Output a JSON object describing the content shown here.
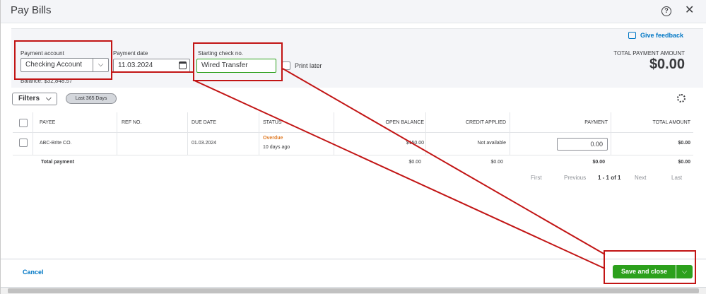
{
  "dialog": {
    "title": "Pay Bills"
  },
  "form": {
    "payment_account_label": "Payment account",
    "payment_account_value": "Checking Account",
    "payment_date_label": "Payment date",
    "payment_date_value": "11.03.2024",
    "starting_check_label": "Starting check no.",
    "starting_check_value": "Wired Transfer",
    "print_later_label": "Print later",
    "balance_text": "Balance: $32,848.57"
  },
  "summary": {
    "feedback_label": "Give feedback",
    "total_payment_label": "TOTAL PAYMENT AMOUNT",
    "total_payment_value": "$0.00"
  },
  "filters": {
    "button_label": "Filters",
    "chip_label": "Last 365 Days"
  },
  "table": {
    "headers": {
      "payee": "PAYEE",
      "ref_no": "REF NO.",
      "due_date": "DUE DATE",
      "status": "STATUS",
      "open_balance": "OPEN BALANCE",
      "credit_applied": "CREDIT APPLIED",
      "payment": "PAYMENT",
      "total_amount": "TOTAL AMOUNT"
    },
    "rows": [
      {
        "payee": "ABC-Brite CO.",
        "ref_no": "",
        "due_date": "01.03.2024",
        "status": "Overdue",
        "status_detail": "10 days ago",
        "open_balance": "$150.00",
        "credit_applied": "Not available",
        "payment": "0.00",
        "total_amount": "$0.00"
      }
    ],
    "totals": {
      "label": "Total payment",
      "open_balance": "$0.00",
      "credit_applied": "$0.00",
      "payment": "$0.00",
      "total_amount": "$0.00"
    }
  },
  "pagination": {
    "first": "First",
    "previous": "Previous",
    "current": "1 - 1 of 1",
    "next": "Next",
    "last": "Last"
  },
  "footer": {
    "cancel_label": "Cancel",
    "save_label": "Save and close"
  },
  "colors": {
    "accent_green": "#2ca01c",
    "link_blue": "#0077c5",
    "annotation_red": "#c21515",
    "overdue_orange": "#e07d29"
  },
  "icons": {
    "help": "help-icon",
    "close": "close-icon",
    "calendar": "calendar-icon",
    "feedback": "feedback-icon",
    "gear": "gear-icon",
    "chevron": "chevron-down-icon"
  }
}
